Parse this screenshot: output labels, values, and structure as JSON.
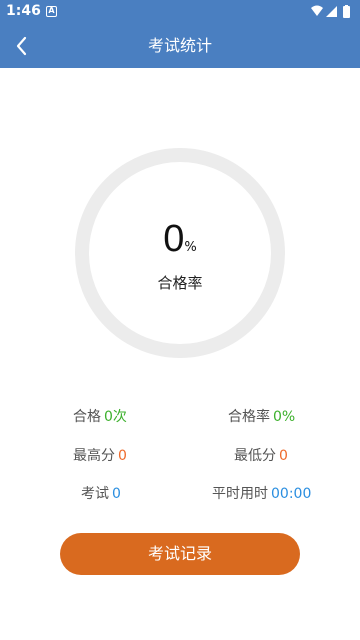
{
  "status_bar": {
    "time": "1:46",
    "notification_icon": "A"
  },
  "app_bar": {
    "title": "考试统计",
    "back_icon": "chevron-left-icon"
  },
  "pass_rate": {
    "value": "0",
    "unit": "%",
    "label": "合格率",
    "fraction": 0
  },
  "stats": {
    "passed": {
      "label": "合格",
      "value": "0次"
    },
    "pass_rate": {
      "label": "合格率",
      "value": "0%"
    },
    "highest": {
      "label": "最高分",
      "value": "0"
    },
    "lowest": {
      "label": "最低分",
      "value": "0"
    },
    "exams": {
      "label": "考试",
      "value": "0"
    },
    "avg_time": {
      "label": "平时用时",
      "value": "00:00"
    }
  },
  "record_button": {
    "label": "考试记录"
  },
  "colors": {
    "primary": "#4a7fc1",
    "accent": "#d96a1f",
    "green": "#3cb02c",
    "orange": "#ee6a2b",
    "blue": "#2a8ee0",
    "ring": "#ececec"
  }
}
